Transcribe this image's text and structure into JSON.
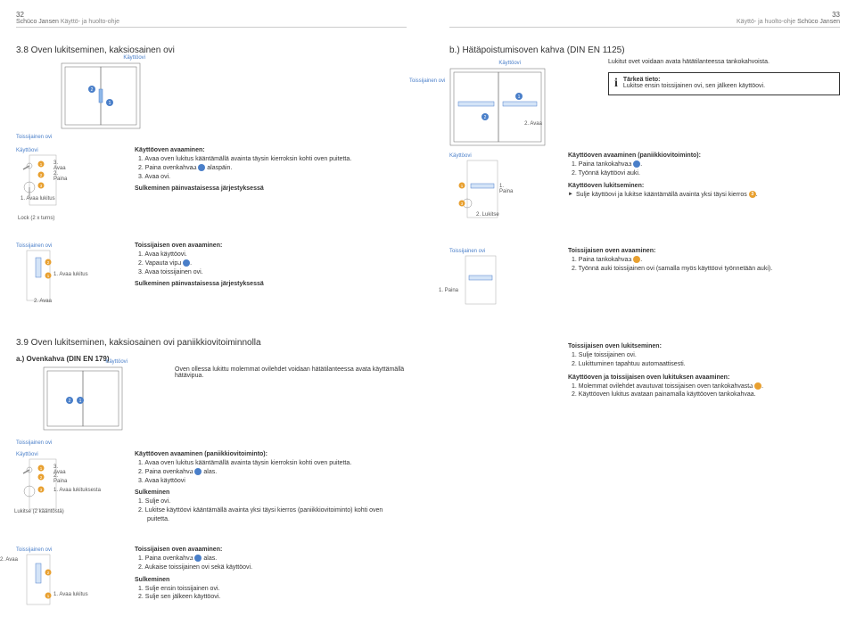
{
  "header": {
    "leftNum": "32",
    "rightNum": "33",
    "brand": "Schüco Jansen",
    "sub": "Käyttö- ja huolto-ohje"
  },
  "s38": {
    "title": "3.8 Oven lukitseminen, kaksiosainen ovi",
    "d1": {
      "kayttoovi": "Käyttöovi",
      "toissijainen": "Toissijainen ovi",
      "n1": "1",
      "n2": "2"
    },
    "d2": {
      "kayttoovi": "Käyttöovi",
      "l1": "1",
      "l2": "2",
      "l3": "3",
      "t1": "1. Avaa lukitus",
      "t2": "2. Paina",
      "t3": "3. Avaa",
      "lock": "Lock (2 x turns)"
    },
    "inst1": {
      "title": "Käyttöoven avaaminen:",
      "i1": "1. Avaa oven lukitus kääntämällä avainta täysin kierroksin kohti oven puitetta.",
      "i2a": "2. Paina ovenkahvaa ",
      "i2b": " alaspäin.",
      "i3": "3. Avaa ovi.",
      "close": "Sulkeminen päinvastaisessa järjestyksessä"
    },
    "d3": {
      "toissijainen": "Toissijainen ovi",
      "n1": "1",
      "n2": "2",
      "t1": "1. Avaa lukitus",
      "t2": "2. Avaa"
    },
    "inst2": {
      "title": "Toissijaisen oven avaaminen:",
      "i1": "1. Avaa käyttöovi.",
      "i2a": "2. Vapauta vipu ",
      "i2b": ".",
      "i3": "3. Avaa toissijainen ovi.",
      "close": "Sulkeminen päinvastaisessa järjestyksessä"
    }
  },
  "s39": {
    "title": "3.9 Oven lukitseminen, kaksiosainen ovi paniikkiovitoiminnolla",
    "a_title": "a.) Ovenkahva (DIN EN 179)",
    "txt": "Oven ollessa lukittu molemmat ovilehdet voidaan hätätilanteessa avata käyttämällä hätävipua.",
    "d4": {
      "kayttoovi": "Käyttöovi",
      "toissijainen": "Toissijainen ovi",
      "n1": "1",
      "n2": "2"
    },
    "d5": {
      "kayttoovi": "Käyttöovi",
      "n1": "1",
      "n2": "2",
      "n3": "3",
      "t1": "1. Avaa lukituksesta",
      "t2": "2. Paina",
      "t3": "3. Avaa",
      "lock": "Lukitse (2 kääntöstä)"
    },
    "inst3": {
      "title": "Käyttöoven avaaminen (paniikkiovitoiminto):",
      "i1": "1. Avaa oven lukitus kääntämällä avainta täysin kierroksin kohti oven puitetta.",
      "i2a": "2. Paina ovenkahva ",
      "i2b": " alas.",
      "i3": "3. Avaa käyttöovi"
    },
    "sulk": {
      "title": "Sulkeminen",
      "i1": "1. Sulje ovi.",
      "i2": "2. Lukitse käyttöovi kääntämällä avainta yksi täysi kierros (paniikkiovitoiminto) kohti oven puitetta."
    },
    "d6": {
      "toissijainen": "Toissijainen ovi",
      "n1": "1",
      "n2": "2",
      "t1": "1. Avaa lukitus",
      "t2": "2. Avaa"
    },
    "inst4": {
      "title": "Toissijaisen oven avaaminen:",
      "i1a": "1. Paina ovenkahva ",
      "i1b": " alas.",
      "i2": "2. Aukaise toissijainen ovi sekä käyttöovi."
    },
    "sulk2": {
      "title": "Sulkeminen",
      "i1": "1. Sulje ensin toissijainen ovi.",
      "i2": "2. Sulje sen jälkeen käyttöovi."
    }
  },
  "right": {
    "b_title": "b.) Hätäpoistumisoven kahva (DIN EN 1125)",
    "intro": "Lukitut ovet voidaan avata hätätilanteessa tankokahvoista.",
    "info_title": "Tärkeä tieto:",
    "info_text": "Lukitse ensin toissijainen ovi, sen jälkeen käyttöovi.",
    "rd1": {
      "kayttoovi": "Käyttöovi",
      "toissijainen": "Toissijainen ovi",
      "n1": "1",
      "n2": "2",
      "t2": "2. Avaa"
    },
    "rd2": {
      "kayttoovi": "Käyttöovi",
      "n1": "1",
      "n3": "3",
      "t1": "1. Paina",
      "t2": "2. Lukitse"
    },
    "r1": {
      "title": "Käyttöoven avaaminen (paniikkiovitoiminto):",
      "i1a": "1. Paina tankokahvaa ",
      "i1b": ".",
      "i2": "2. Työnnä käyttöovi auki."
    },
    "r2": {
      "title": "Käyttöoven lukitseminen:",
      "txt_a": "Sulje käyttöovi ja lukitse kääntämällä avainta yksi täysi kierros ",
      "txt_b": "."
    },
    "rd3": {
      "toissijainen": "Toissijainen ovi",
      "t1": "1. Paina"
    },
    "r3": {
      "title": "Toissijaisen oven avaaminen:",
      "i1a": "1. Paina tankokahvaa ",
      "i1b": ".",
      "i2": "2. Työnnä auki toissijainen ovi (samalla myös käyttöovi työnnetään auki)."
    },
    "r4": {
      "title": "Toissijaisen oven lukitseminen:",
      "i1": "1. Sulje toissijainen ovi.",
      "i2": "2. Lukittuminen tapahtuu automaattisesti."
    },
    "r5": {
      "title": "Käyttöoven ja toissijaisen oven lukituksen avaaminen:",
      "i1a": "1. Molemmat ovilehdet avautuvat toissijaisen oven tankokahvasta ",
      "i1b": ".",
      "i2": "2. Käyttöoven lukitus avataan painamalla käyttöoven tankokahvaa."
    }
  }
}
